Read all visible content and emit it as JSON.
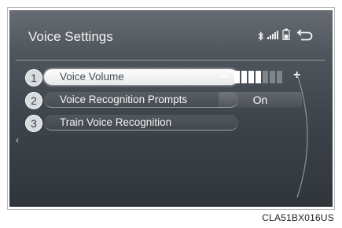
{
  "screen": {
    "title": "Voice Settings",
    "status_icons": [
      "bluetooth-icon",
      "signal-icon",
      "battery-icon"
    ],
    "back_icon": "back-arrow-icon"
  },
  "settings": [
    {
      "number": "1",
      "label": "Voice Volume",
      "selected": true
    },
    {
      "number": "2",
      "label": "Voice Recognition Prompts",
      "value": "On"
    },
    {
      "number": "3",
      "label": "Train Voice Recognition"
    }
  ],
  "volume": {
    "minus_label": "–",
    "plus_label": "+",
    "bars_total": 7,
    "bars_filled": 4
  },
  "figure_code": "CLA51BX016US",
  "colors": {
    "screen_bg": "#4a5057",
    "selected_button": "#f4f5f6",
    "text": "#f2f2f2"
  }
}
